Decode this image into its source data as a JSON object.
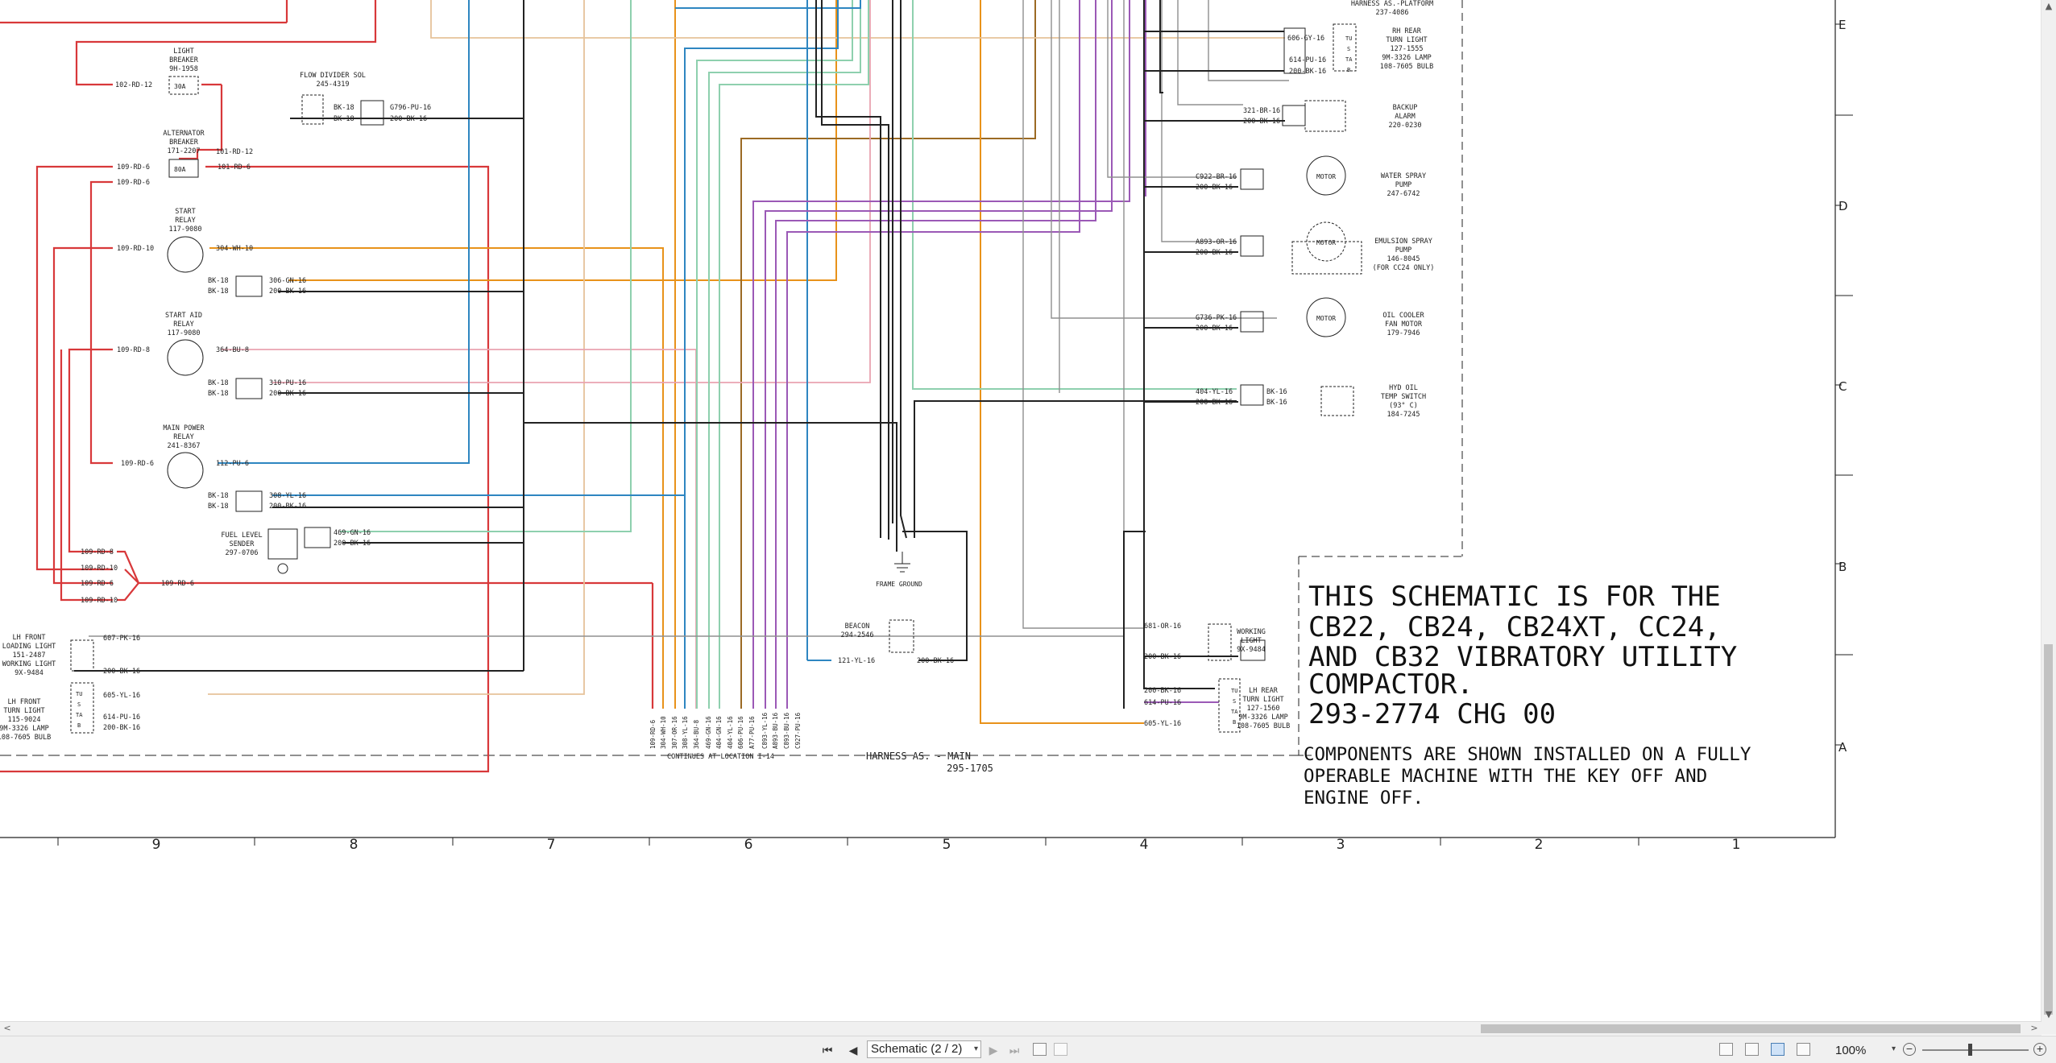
{
  "sheet": {
    "harness_platform": {
      "name": "HARNESS AS.-PLATFORM",
      "part": "237-4086"
    },
    "harness_main": {
      "name": "HARNESS AS. - MAIN",
      "part": "295-1705"
    },
    "continues_label": "CONTINUES AT LOCATION I-14",
    "notes": {
      "title_lines": [
        "THIS SCHEMATIC IS FOR THE",
        "CB22, CB24, CB24XT, CC24,",
        "AND CB32 VIBRATORY UTILITY",
        "COMPACTOR.",
        "293-2774 CHG 00"
      ],
      "components_lines": [
        "COMPONENTS ARE SHOWN INSTALLED ON A FULLY",
        "OPERABLE MACHINE WITH THE KEY OFF AND",
        "ENGINE OFF."
      ]
    },
    "grid_columns": [
      "9",
      "8",
      "7",
      "6",
      "5",
      "4",
      "3",
      "2",
      "1"
    ],
    "grid_rows": [
      "E",
      "D",
      "C",
      "B",
      "A"
    ],
    "components": {
      "light_breaker": [
        "LIGHT",
        "BREAKER",
        "9H-1958"
      ],
      "light_breaker_rating": "30A",
      "alternator_breaker": [
        "ALTERNATOR",
        "BREAKER",
        "171-2207"
      ],
      "alternator_breaker_rating": "80A",
      "flow_divider": [
        "FLOW DIVIDER SOL",
        "245-4319"
      ],
      "start_relay": [
        "START",
        "RELAY",
        "117-9080"
      ],
      "start_aid_relay": [
        "START AID",
        "RELAY",
        "117-9080"
      ],
      "main_power_relay": [
        "MAIN POWER",
        "RELAY",
        "241-8367"
      ],
      "fuel_level_sender": [
        "FUEL LEVEL",
        "SENDER",
        "297-0706"
      ],
      "lh_front_light": [
        "LH FRONT",
        "LOADING LIGHT",
        "151-2487",
        "WORKING LIGHT",
        "9X-9484"
      ],
      "lh_front_turn": [
        "LH FRONT",
        "TURN LIGHT",
        "115-9024",
        "9M-3326 LAMP",
        "108-7605 BULB"
      ],
      "frame_ground": "FRAME GROUND",
      "beacon": [
        "BEACON",
        "294-2546"
      ],
      "rh_rear_turn": [
        "RH REAR",
        "TURN LIGHT",
        "127-1555",
        "9M-3326 LAMP",
        "108-7605 BULB"
      ],
      "backup_alarm": [
        "BACKUP",
        "ALARM",
        "220-0230"
      ],
      "water_spray_pump": [
        "WATER SPRAY",
        "PUMP",
        "247-6742"
      ],
      "emulsion_spray_pump": [
        "EMULSION SPRAY",
        "PUMP",
        "146-8045",
        "(FOR CC24 ONLY)"
      ],
      "oil_cooler_fan": [
        "OIL COOLER",
        "FAN MOTOR",
        "179-7946"
      ],
      "hyd_oil_temp": [
        "HYD OIL",
        "TEMP SWITCH",
        "(93° C)",
        "184-7245"
      ],
      "working_light": [
        "WORKING",
        "LIGHT",
        "9X-9484"
      ],
      "lh_rear_turn": [
        "LH REAR",
        "TURN LIGHT",
        "127-1560",
        "9M-3326 LAMP",
        "108-7605 BULB"
      ],
      "motor_label": "MOTOR"
    },
    "wire_labels": {
      "w102": "102-RD-12",
      "w101a": "101-RD-12",
      "w101b": "101-RD-6",
      "w109_6": "109-RD-6",
      "w109_10": "109-RD-10",
      "w109_8": "109-RD-8",
      "w304": "304-WH-10",
      "w364": "364-BU-8",
      "w112": "112-PU-6",
      "w306": "306-GN-16",
      "w310": "310-PU-16",
      "w308": "308-YL-16",
      "w469": "469-GN-16",
      "w200": "200-BK-16",
      "bk18": "BK-18",
      "bk16": "BK-16",
      "g796": "G796-PU-16",
      "w607": "607-PK-16",
      "w605": "605-YL-16",
      "w614": "614-PU-16",
      "w606": "606-GY-16",
      "w321": "321-BR-16",
      "c922": "C922-BR-16",
      "a893": "A893-OR-16",
      "g736": "G736-PK-16",
      "w404": "404-YL-16",
      "w681": "681-OR-16",
      "w121": "121-YL-16"
    },
    "bundle_labels": [
      "109-RD-6",
      "304-WH-10",
      "307-OR-16",
      "308-YL-16",
      "364-BU-8",
      "469-GN-16",
      "404-GN-16",
      "404-YL-16",
      "606-PU-16",
      "A77-PU-16",
      "C893-YL-16",
      "A893-BU-16",
      "C893-BU-16",
      "C927-PU-16"
    ],
    "lamp_pins": [
      "TU",
      "S",
      "TA",
      "B"
    ]
  },
  "viewer": {
    "page_selector": "Schematic (2 / 2)",
    "zoom": "100%",
    "icons": {
      "first": "⏮",
      "prev": "◀",
      "next": "▶",
      "last": "⏭",
      "scroll_up": "▲",
      "scroll_down": "▼",
      "scroll_left": "<",
      "scroll_right": ">",
      "zoom_out": "−",
      "zoom_in": "+",
      "dropdown": "▾"
    }
  },
  "colors": {
    "red": "#d8383a",
    "orange": "#e8921a",
    "green": "#8ed0ae",
    "blue": "#2e86c1",
    "purple": "#9b59b6",
    "pink": "#e9a3b0",
    "tan": "#e6c29a",
    "brown": "#9b6a24",
    "gray": "#8f8f8f",
    "black": "#222222"
  }
}
